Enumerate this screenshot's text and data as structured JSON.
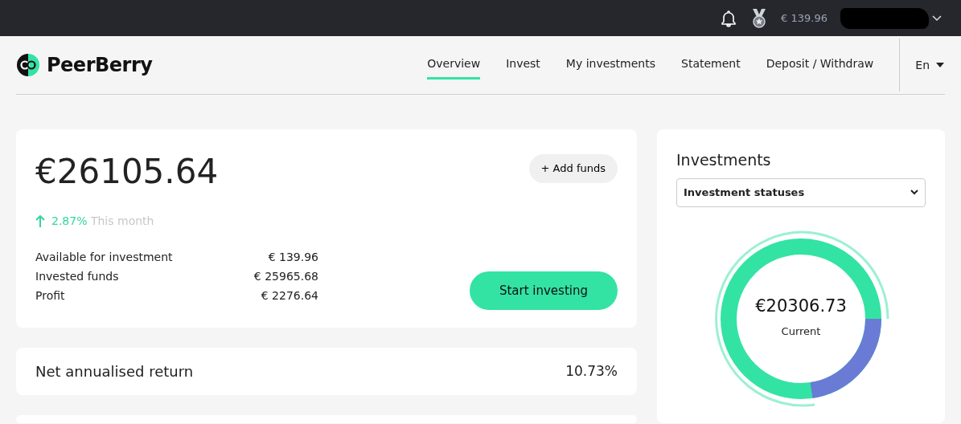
{
  "topbar": {
    "balance": "€ 139.96"
  },
  "brand": {
    "name": "PeerBerry"
  },
  "nav": [
    {
      "label": "Overview",
      "selected": true
    },
    {
      "label": "Invest",
      "selected": false
    },
    {
      "label": "My investments",
      "selected": false
    },
    {
      "label": "Statement",
      "selected": false
    },
    {
      "label": "Deposit / Withdraw",
      "selected": false
    }
  ],
  "language": "En",
  "summary": {
    "total": "€26105.64",
    "change": "2.87%",
    "change_label": "This month",
    "add_funds": "+ Add funds",
    "start": "Start investing",
    "rows": [
      {
        "label": "Available for investment",
        "value": "€ 139.96"
      },
      {
        "label": "Invested funds",
        "value": "€ 25965.68"
      },
      {
        "label": "Profit",
        "value": "€ 2276.64"
      }
    ]
  },
  "return": {
    "label": "Net annualised return",
    "value": "10.73%"
  },
  "investments": {
    "title": "Investments",
    "select": "Investment statuses",
    "center_value": "€20306.73",
    "center_label": "Current"
  }
}
